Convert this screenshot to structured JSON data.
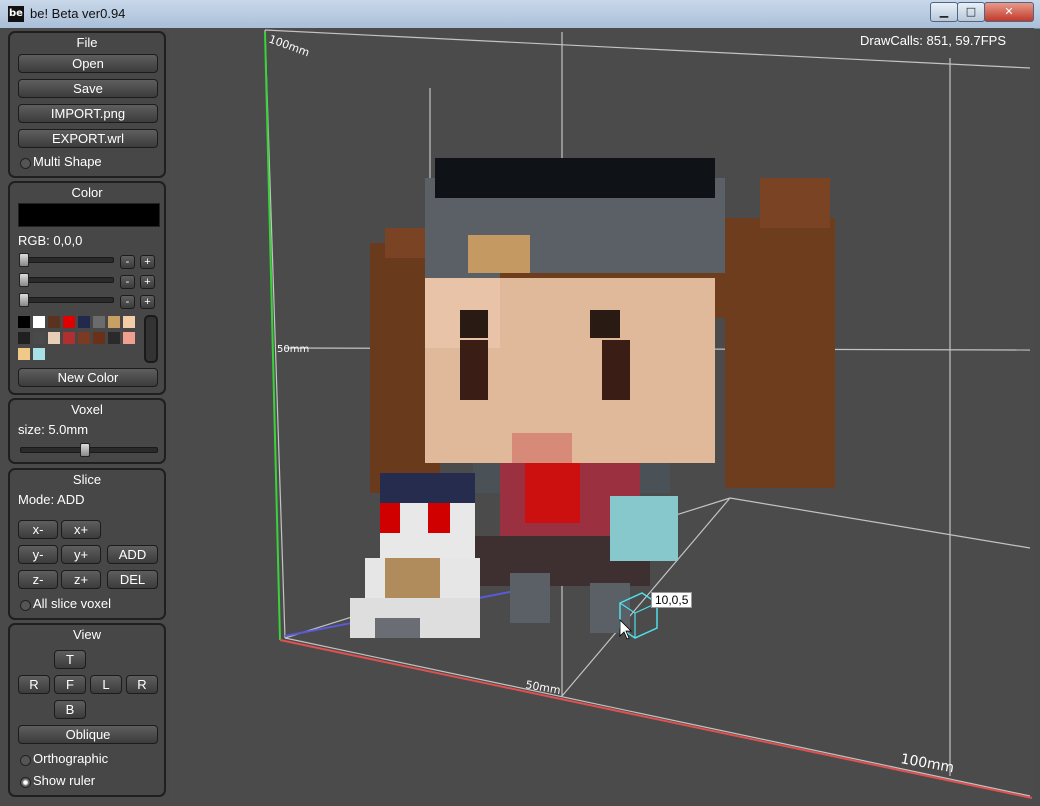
{
  "window": {
    "title": "be! Beta ver0.94",
    "icon_label": "be",
    "buttons": [
      "▁",
      "□",
      "✕"
    ]
  },
  "file": {
    "title": "File",
    "buttons": [
      "Open",
      "Save",
      "IMPORT.png",
      "EXPORT.wrl"
    ],
    "multi_shape_label": "Multi Shape"
  },
  "color": {
    "title": "Color",
    "current_color": "#000000",
    "rgb_label": "RGB: 0,0,0",
    "minus": "-",
    "plus": "+",
    "palette": [
      "#000000",
      "#ffffff",
      "#5a3220",
      "#e00000",
      "#22294a",
      "#6b6b6b",
      "#c8a064",
      "#f2cda8",
      "#202020",
      "#4a4a4a",
      "#e8cdb8",
      "#b03030",
      "#7a3b22",
      "#6a3018",
      "#2a2a2a",
      "#f0a090",
      "#f0c888",
      "#a8e0e8"
    ],
    "new_color_label": "New Color"
  },
  "voxel": {
    "title": "Voxel",
    "size_label": "size: 5.0mm",
    "size_value": 0.5
  },
  "slice": {
    "title": "Slice",
    "mode_label": "Mode: ADD",
    "buttons": {
      "xm": "x-",
      "xp": "x+",
      "ym": "y-",
      "yp": "y+",
      "add": "ADD",
      "zm": "z-",
      "zp": "z+",
      "del": "DEL"
    },
    "all_slice_label": "All slice voxel"
  },
  "view": {
    "title": "View",
    "buttons": {
      "top": "T",
      "right1": "R",
      "front": "F",
      "left": "L",
      "right2": "R",
      "bottom": "B",
      "oblique": "Oblique"
    },
    "orthographic_label": "Orthographic",
    "show_ruler_label": "Show ruler"
  },
  "viewport": {
    "drawcalls": "DrawCalls: 851, 59.7FPS",
    "cursor_coord": "10,0,5",
    "rulers": [
      "100mm",
      "50mm",
      "50mm",
      "100mm"
    ]
  }
}
